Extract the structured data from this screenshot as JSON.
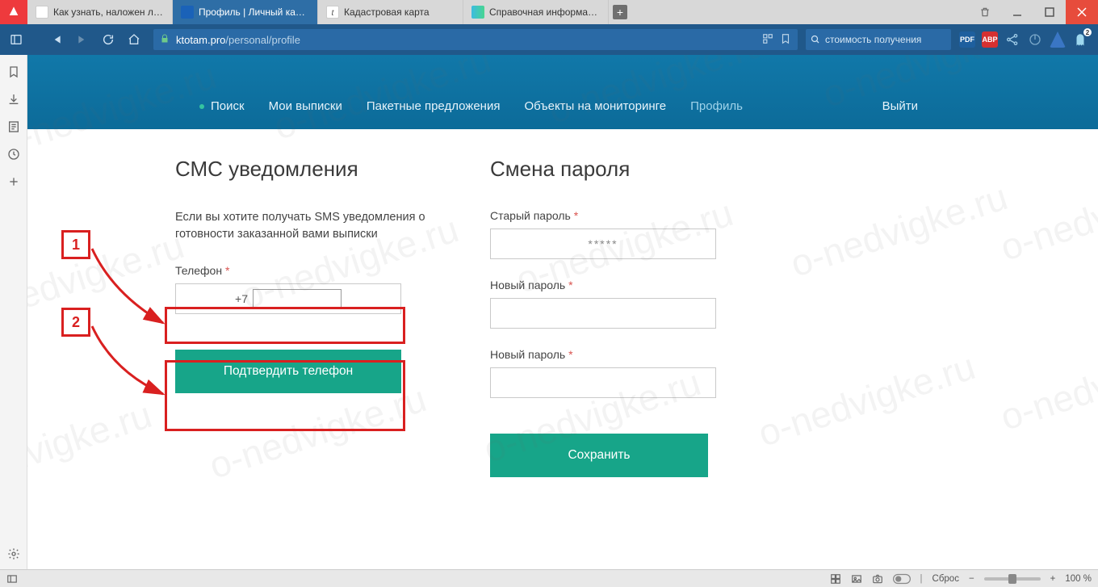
{
  "tabs": [
    {
      "label": "Как узнать, наложен ли аре",
      "favicon": "#f2f2f2"
    },
    {
      "label": "Профиль | Личный кабинет",
      "favicon": "#1a62b8",
      "active": true
    },
    {
      "label": "Кадастровая карта",
      "favicon": "#f2f2f2"
    },
    {
      "label": "Справочная информация п",
      "favicon": "#f2f2f2"
    }
  ],
  "address": {
    "host": "ktotam.pro",
    "path": "/personal/profile"
  },
  "searchbox": "стоимость получения",
  "sitenav": {
    "items": [
      "Поиск",
      "Мои выписки",
      "Пакетные предложения",
      "Объекты на мониторинге",
      "Профиль"
    ],
    "exit": "Выйти"
  },
  "sms": {
    "heading": "СМС уведомления",
    "descr": "Если вы хотите получать SMS уведомления о готовности заказанной вами выписки",
    "phone_label": "Телефон",
    "phone_prefix": "+7",
    "confirm_btn": "Подтвердить телефон"
  },
  "pw": {
    "heading": "Смена пароля",
    "old_label": "Старый пароль",
    "new_label": "Новый пароль",
    "new2_label": "Новый пароль",
    "old_value": "*****",
    "save_btn": "Сохранить"
  },
  "anno": {
    "one": "1",
    "two": "2"
  },
  "watermark": "o-nedvigke.ru",
  "status": {
    "reset": "Сброс",
    "zoom": "100 %"
  },
  "badge": "2"
}
